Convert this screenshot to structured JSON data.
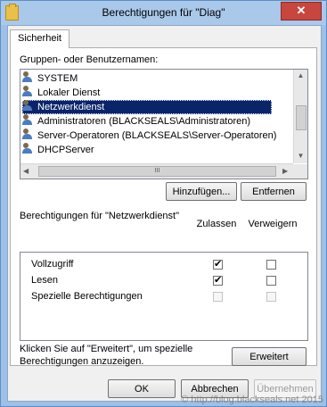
{
  "window": {
    "title": "Berechtigungen für \"Diag\"",
    "close_glyph": "✕"
  },
  "tab": {
    "label": "Sicherheit"
  },
  "groups_label": "Gruppen- oder Benutzernamen:",
  "principals": [
    {
      "name": "SYSTEM",
      "selected": false
    },
    {
      "name": "Lokaler Dienst",
      "selected": false
    },
    {
      "name": "Netzwerkdienst",
      "selected": true
    },
    {
      "name": "Administratoren (BLACKSEALS\\Administratoren)",
      "selected": false
    },
    {
      "name": "Server-Operatoren (BLACKSEALS\\Server-Operatoren)",
      "selected": false
    },
    {
      "name": "DHCPServer",
      "selected": false
    }
  ],
  "scroll": {
    "up": "▲",
    "down": "▼",
    "left": "◀",
    "right": "▶",
    "grip": "III"
  },
  "buttons": {
    "add": "Hinzufügen...",
    "remove": "Entfernen",
    "advanced": "Erweitert",
    "ok": "OK",
    "cancel": "Abbrechen",
    "apply": "Übernehmen"
  },
  "permissions_for_label": "Berechtigungen für \"Netzwerkdienst\"",
  "columns": {
    "allow": "Zulassen",
    "deny": "Verweigern"
  },
  "permissions": [
    {
      "name": "Vollzugriff",
      "allow": "✔",
      "deny": ""
    },
    {
      "name": "Lesen",
      "allow": "✔",
      "deny": ""
    },
    {
      "name": "Spezielle Berechtigungen",
      "allow": "",
      "deny": ""
    }
  ],
  "advanced_hint": "Klicken Sie auf \"Erweitert\", um spezielle Berechtigungen anzuzeigen.",
  "watermark": "© http://blog.blackseals.net 2015"
}
